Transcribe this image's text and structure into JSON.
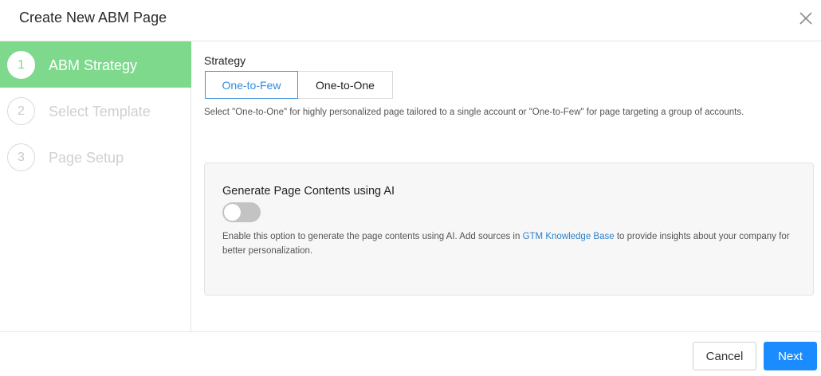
{
  "dialog": {
    "title": "Create New ABM Page",
    "close_icon": "close-icon"
  },
  "steps": [
    {
      "number": "1",
      "label": "ABM Strategy",
      "state": "active"
    },
    {
      "number": "2",
      "label": "Select Template",
      "state": "inactive"
    },
    {
      "number": "3",
      "label": "Page Setup",
      "state": "inactive"
    }
  ],
  "strategy": {
    "label": "Strategy",
    "options": [
      "One-to-Few",
      "One-to-One"
    ],
    "selected": "One-to-Few",
    "helper": "Select \"One-to-One\" for highly personalized page tailored to a single account or \"One-to-Few\" for page targeting a group of accounts."
  },
  "ai": {
    "title": "Generate Page Contents using AI",
    "toggle_on": false,
    "desc_before": "Enable this option to generate the page contents using AI. Add sources in ",
    "link": "GTM Knowledge Base",
    "desc_after": " to provide insights about your company for better personalization."
  },
  "footer": {
    "cancel": "Cancel",
    "next": "Next"
  },
  "colors": {
    "active_step": "#7fd98d",
    "accent": "#1a8cff",
    "link": "#2f80c8"
  }
}
